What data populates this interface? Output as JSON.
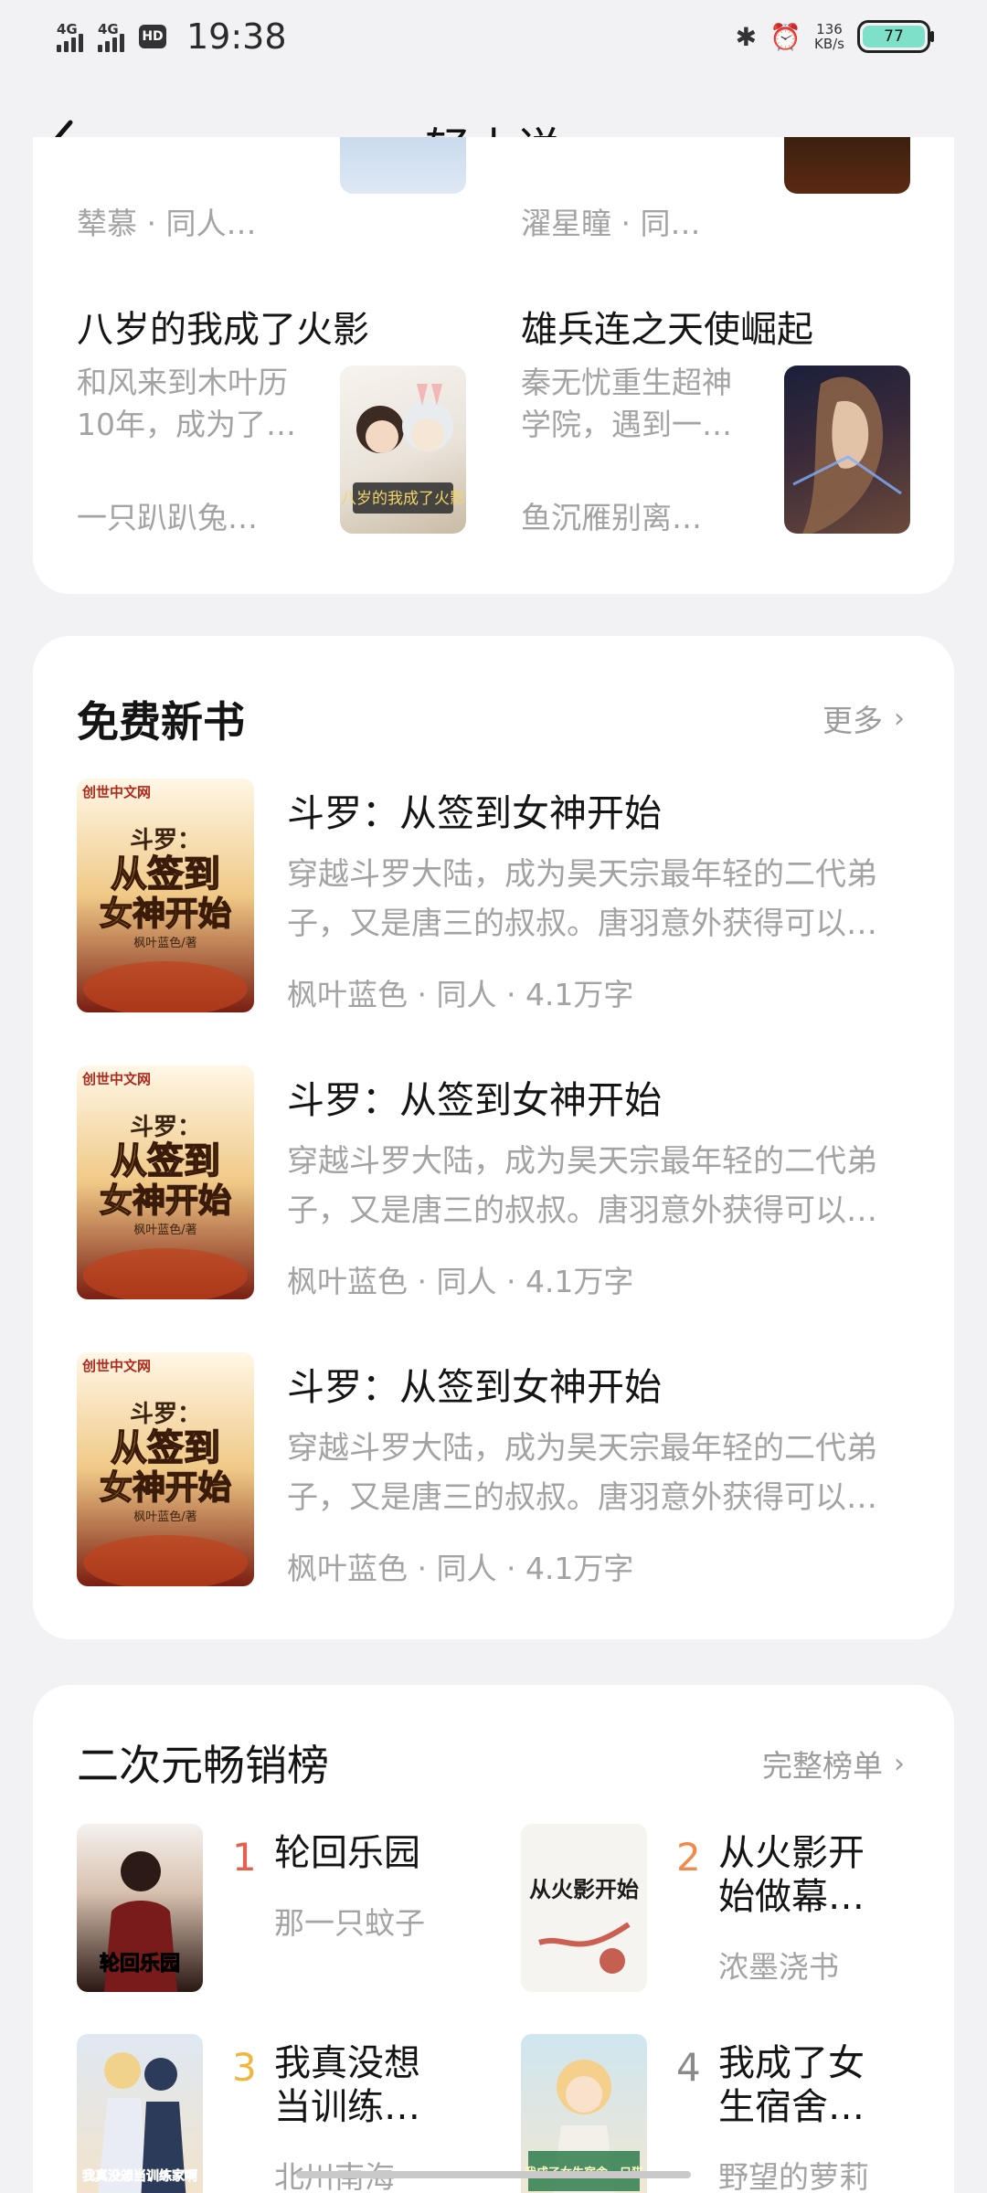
{
  "status": {
    "network1": "4G",
    "network2": "4G",
    "hd": "HD",
    "time": "19:38",
    "speed_value": "136",
    "speed_unit": "KB/s",
    "battery": "77"
  },
  "header": {
    "title": "轻小说"
  },
  "top_grid": {
    "partial": [
      {
        "meta": "辇慕 · 同人…"
      },
      {
        "meta": "濯星瞳 · 同…"
      }
    ],
    "books": [
      {
        "title": "八岁的我成了火影",
        "desc": "和风来到木叶历10年，成为了…",
        "author": "一只趴趴兔…",
        "cover_text": "八岁的我成了火影"
      },
      {
        "title": "雄兵连之天使崛起",
        "desc": "秦无忧重生超神学院，遇到一…",
        "author": "鱼沉雁别离…",
        "cover_text": ""
      }
    ]
  },
  "free_books": {
    "title": "免费新书",
    "more": "更多",
    "items": [
      {
        "title": "斗罗：从签到女神开始",
        "desc": "穿越斗罗大陆，成为昊天宗最年轻的二代弟子，又是唐三的叔叔。唐羽意外获得可以…",
        "meta": "枫叶蓝色 · 同人 · 4.1万字",
        "cover_badge": "创世中文网",
        "cover_line1": "斗罗：",
        "cover_line2": "从签到",
        "cover_line3": "女神开始",
        "cover_author": "枫叶蓝色/著"
      },
      {
        "title": "斗罗：从签到女神开始",
        "desc": "穿越斗罗大陆，成为昊天宗最年轻的二代弟子，又是唐三的叔叔。唐羽意外获得可以…",
        "meta": "枫叶蓝色 · 同人 · 4.1万字",
        "cover_badge": "创世中文网",
        "cover_line1": "斗罗：",
        "cover_line2": "从签到",
        "cover_line3": "女神开始",
        "cover_author": "枫叶蓝色/著"
      },
      {
        "title": "斗罗：从签到女神开始",
        "desc": "穿越斗罗大陆，成为昊天宗最年轻的二代弟子，又是唐三的叔叔。唐羽意外获得可以…",
        "meta": "枫叶蓝色 · 同人 · 4.1万字",
        "cover_badge": "创世中文网",
        "cover_line1": "斗罗：",
        "cover_line2": "从签到",
        "cover_line3": "女神开始",
        "cover_author": "枫叶蓝色/著"
      }
    ]
  },
  "ranking": {
    "title": "二次元畅销榜",
    "more": "完整榜单",
    "items": [
      {
        "rank": "1",
        "title": "轮回乐园",
        "author": "那一只蚊子",
        "rank_color": "#e8604c",
        "cover_text": "轮回乐园"
      },
      {
        "rank": "2",
        "title": "从火影开始做幕…",
        "author": "浓墨浇书",
        "rank_color": "#f08a4b",
        "cover_text": "从火影开始"
      },
      {
        "rank": "3",
        "title": "我真没想当训练…",
        "author": "北川南海",
        "rank_color": "#f0b640",
        "cover_text": "我真没想当训练家啊"
      },
      {
        "rank": "4",
        "title": "我成了女生宿舍…",
        "author": "野望的萝莉",
        "rank_color": "#8a8a8a",
        "cover_text": "我成了女生宿舍一只猫"
      }
    ]
  }
}
